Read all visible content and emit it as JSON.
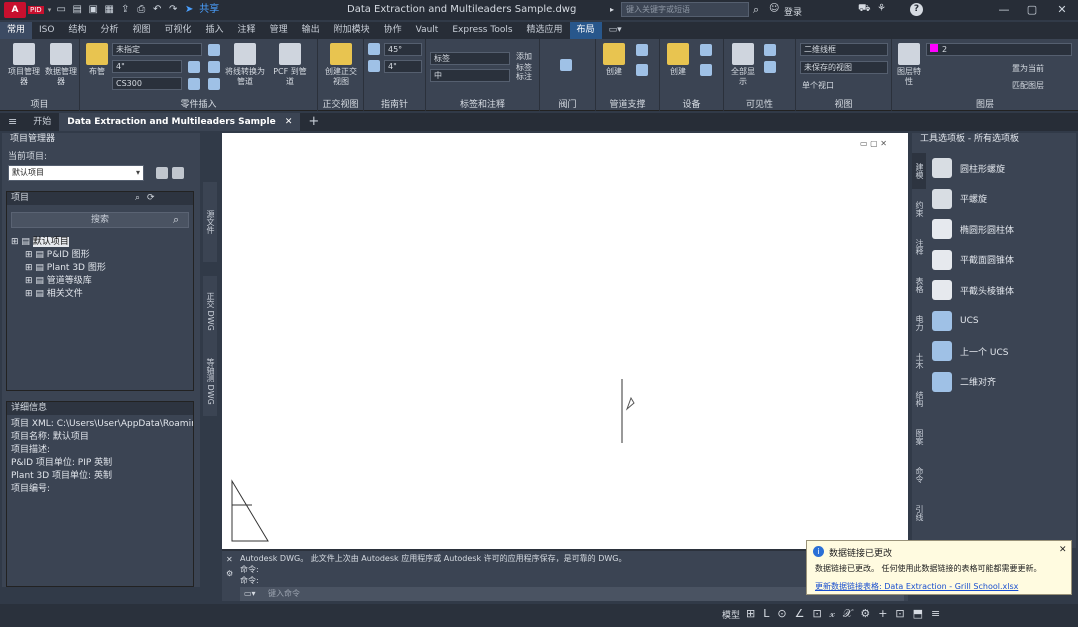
{
  "app": {
    "logo_text": "A",
    "logo_badge": "PID",
    "title": "Data Extraction and Multileaders Sample.dwg",
    "search_placeholder": "键入关键字或短语",
    "signin": "登录",
    "share": "共享"
  },
  "ribbon_tabs": [
    "常用",
    "ISO",
    "结构",
    "分析",
    "视图",
    "可视化",
    "插入",
    "注释",
    "管理",
    "输出",
    "附加模块",
    "协作",
    "Vault",
    "Express Tools",
    "精选应用",
    "布局"
  ],
  "ribbon": {
    "project": {
      "title": "项目",
      "btn1": "项目管理器",
      "btn2": "数据管理器"
    },
    "parts": {
      "title": "零件插入",
      "btn1": "布管",
      "btn2": "将线转换为管道",
      "btn3": "PCF 到管道",
      "combo1": "未指定",
      "combo2": "4\"",
      "combo3": "CS300"
    },
    "ortho": {
      "title": "正交视图",
      "btn": "创建正交视图"
    },
    "compass": {
      "title": "指南针",
      "val1": "45°",
      "val2": "4\""
    },
    "tags": {
      "title": "标签和注释",
      "combo1": "标签",
      "combo2": "中",
      "btn1": "添加标签",
      "btn2": "标注"
    },
    "valve": {
      "title": "阀门"
    },
    "pipe_support": {
      "title": "管道支撑",
      "btn": "创建"
    },
    "equipment": {
      "title": "设备",
      "btn": "创建"
    },
    "visibility": {
      "title": "可见性",
      "btn": "全部显示"
    },
    "view": {
      "title": "视图",
      "combo1": "二维线框",
      "combo2": "未保存的视图",
      "combo3": "单个视口"
    },
    "layers": {
      "title": "图层",
      "btn1": "图层特性",
      "combo": "2",
      "btn2": "置为当前",
      "btn3": "匹配图层"
    }
  },
  "doc_tabs": {
    "start": "开始",
    "current": "Data Extraction and Multileaders Sample",
    "add": "+"
  },
  "project_manager": {
    "title": "项目管理器",
    "current_label": "当前项目:",
    "current_value": "默认项目",
    "project_section": "项目",
    "search_placeholder": "搜索",
    "tree": [
      {
        "label": "默认项目",
        "level": 0
      },
      {
        "label": "P&ID 图形",
        "level": 1
      },
      {
        "label": "Plant 3D 图形",
        "level": 1
      },
      {
        "label": "管道等级库",
        "level": 1
      },
      {
        "label": "相关文件",
        "level": 1
      }
    ],
    "details_title": "详细信息",
    "details": [
      "项目 XML: C:\\Users\\User\\AppData\\Roamin",
      "项目名称: 默认项目",
      "项目描述:",
      "P&ID 项目单位: PIP 英制",
      "Plant 3D 项目单位: 英制",
      "项目编号:"
    ],
    "side_tabs": [
      "源文件",
      "正交 DWG",
      "等轴测 DWG"
    ]
  },
  "command": {
    "history": [
      "Autodesk DWG。 此文件上次由 Autodesk 应用程序或 Autodesk 许可的应用程序保存，是可靠的 DWG。",
      "命令:",
      "命令:"
    ],
    "prompt": "键入命令"
  },
  "tool_palette": {
    "title": "工具选项板 - 所有选项板",
    "tools": [
      "圆柱形螺旋",
      "平螺旋",
      "椭圆形圆柱体",
      "平截面圆锥体",
      "平截头棱锥体",
      "UCS",
      "上一个 UCS",
      "二维对齐"
    ],
    "side_tabs": [
      "建模",
      "约束",
      "注释",
      "表格",
      "电力",
      "土木",
      "结构",
      "图案",
      "命令",
      "引线"
    ]
  },
  "notification": {
    "title": "数据链接已更改",
    "body": "数据链接已更改。 任何使用此数据链接的表格可能都需要更新。",
    "link": "更新数据链接表格: Data Extraction - Grill School.xlsx"
  },
  "status": {
    "model": "模型",
    "items": [
      "⊞",
      "L",
      "⊙",
      "∠",
      "⊡",
      "𝓍",
      "𝒳",
      "⚙",
      "+",
      "⊡",
      "⬒",
      "≡"
    ]
  }
}
